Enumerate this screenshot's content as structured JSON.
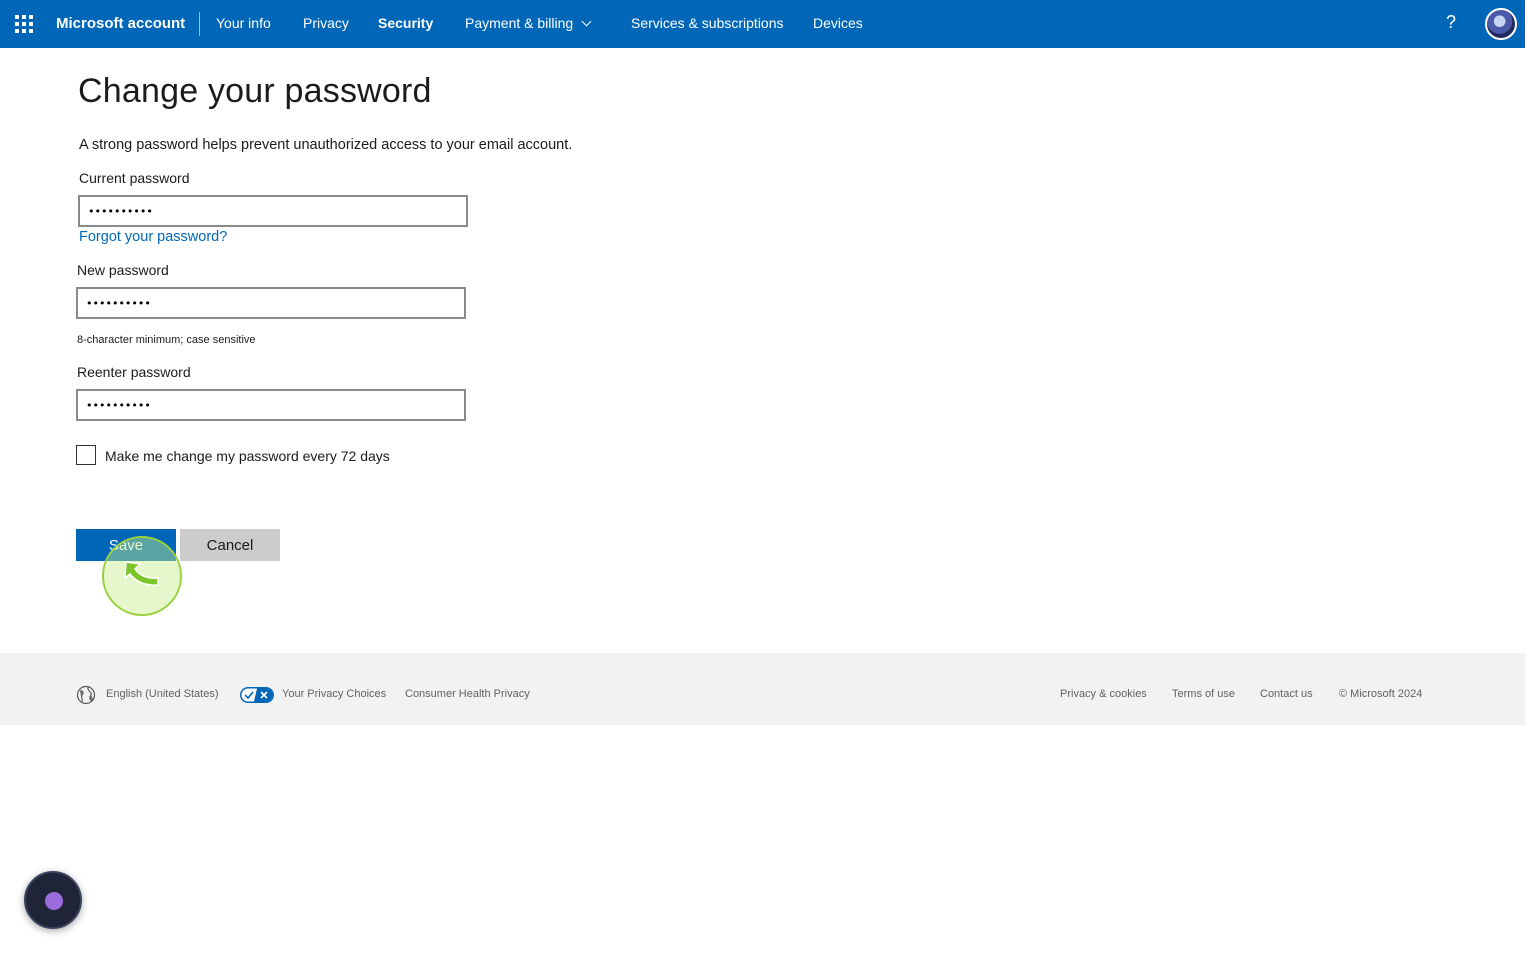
{
  "header": {
    "brand": "Microsoft account",
    "nav": [
      {
        "label": "Your info"
      },
      {
        "label": "Privacy"
      },
      {
        "label": "Security",
        "active": true
      },
      {
        "label": "Payment & billing",
        "has_dropdown": true
      },
      {
        "label": "Services & subscriptions"
      },
      {
        "label": "Devices"
      }
    ],
    "help": "?"
  },
  "main": {
    "title": "Change your password",
    "intro": "A strong password helps prevent unauthorized access to your email account.",
    "current_password": {
      "label": "Current password",
      "value": "••••••••••"
    },
    "forgot_link": "Forgot your password?",
    "new_password": {
      "label": "New password",
      "value": "••••••••••",
      "hint": "8-character minimum; case sensitive"
    },
    "reenter_password": {
      "label": "Reenter password",
      "value": "••••••••••"
    },
    "expire_checkbox": {
      "label": "Make me change my password every 72 days",
      "checked": false
    },
    "save_label": "Save",
    "cancel_label": "Cancel"
  },
  "footer": {
    "language": "English (United States)",
    "privacy_choices": "Your Privacy Choices",
    "health_privacy": "Consumer Health Privacy",
    "privacy_cookies": "Privacy & cookies",
    "terms": "Terms of use",
    "contact": "Contact us",
    "copyright": "© Microsoft 2024"
  },
  "colors": {
    "accent": "#0067b8",
    "footer_bg": "#f2f2f2",
    "click_highlight": "#9bd13f"
  },
  "icons": {
    "app_launcher": "waffle-icon",
    "help": "help-icon",
    "globe": "globe-icon",
    "privacy_toggle": "privacy-choices-icon"
  }
}
